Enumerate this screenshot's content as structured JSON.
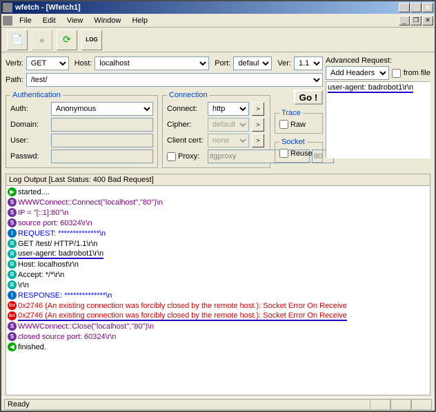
{
  "window": {
    "title": "wfetch - [Wfetch1]"
  },
  "menu": {
    "file": "File",
    "edit": "Edit",
    "view": "View",
    "window": "Window",
    "help": "Help"
  },
  "toolbar": {
    "new": "📄",
    "stop": "✖",
    "refresh": "↻",
    "log": "LOG"
  },
  "form": {
    "verb_lbl": "Verb:",
    "verb": "GET",
    "host_lbl": "Host:",
    "host": "localhost",
    "port_lbl": "Port:",
    "port": "default",
    "ver_lbl": "Ver:",
    "ver": "1.1",
    "path_lbl": "Path:",
    "path": "/test/"
  },
  "auth": {
    "legend": "Authentication",
    "auth_lbl": "Auth:",
    "auth": "Anonymous",
    "domain_lbl": "Domain:",
    "domain": "",
    "user_lbl": "User:",
    "user": "",
    "passwd_lbl": "Passwd:",
    "passwd": ""
  },
  "conn": {
    "legend": "Connection",
    "connect_lbl": "Connect:",
    "connect": "http",
    "cipher_lbl": "Cipher:",
    "cipher": "default",
    "clientcert_lbl": "Client cert:",
    "clientcert": "none",
    "proxy_lbl": "Proxy:",
    "proxy_host": "itgproxy",
    "proxy_port": "80"
  },
  "go": "Go !",
  "trace": {
    "legend": "Trace",
    "raw": "Raw"
  },
  "socket": {
    "legend": "Socket",
    "reuse": "Reuse"
  },
  "adv": {
    "label": "Advanced Request:",
    "select": "Add Headers",
    "fromfile": "from file",
    "body": "user-agent:  badrobot1\\r\\n"
  },
  "log": {
    "header": "Log Output [Last Status: 400 Bad Request]",
    "lines": [
      {
        "badge": "arrow",
        "cls": "t-black",
        "text": "started...."
      },
      {
        "badge": "s",
        "cls": "t-purple",
        "text": "WWWConnect::Connect(\"localhost\",\"80\")\\n"
      },
      {
        "badge": "s",
        "cls": "t-purple",
        "text": "IP = \"[::1]:80\"\\n"
      },
      {
        "badge": "s",
        "cls": "t-purple",
        "text": "source port: 60324\\r\\n"
      },
      {
        "badge": "i",
        "cls": "t-blue",
        "text": "REQUEST: **************\\n"
      },
      {
        "badge": "r",
        "cls": "t-black",
        "text": "GET /test/ HTTP/1.1\\r\\n"
      },
      {
        "badge": "r",
        "cls": "t-black",
        "text": "user-agent:  badrobot1\\r\\n",
        "ul": true
      },
      {
        "badge": "r",
        "cls": "t-black",
        "text": "Host: localhost\\r\\n"
      },
      {
        "badge": "r",
        "cls": "t-black",
        "text": "Accept: */*\\r\\n"
      },
      {
        "badge": "r",
        "cls": "t-black",
        "text": "\\r\\n"
      },
      {
        "badge": "i",
        "cls": "t-blue",
        "text": "RESPONSE: **************\\n"
      },
      {
        "badge": "err",
        "cls": "t-red",
        "text": "0x2746 (An existing connection was forcibly closed by the remote host.): Socket Error On Receive"
      },
      {
        "badge": "err",
        "cls": "t-red",
        "text": "0x2746 (An existing connection was forcibly closed by the remote host.): Socket Error On Receive",
        "ul": true
      },
      {
        "badge": "s",
        "cls": "t-purple",
        "text": "WWWConnect::Close(\"localhost\",\"80\")\\n"
      },
      {
        "badge": "s",
        "cls": "t-purple",
        "text": "closed source port: 60324\\r\\n"
      },
      {
        "badge": "arrowL",
        "cls": "t-black",
        "text": "finished."
      }
    ]
  },
  "status": "Ready"
}
